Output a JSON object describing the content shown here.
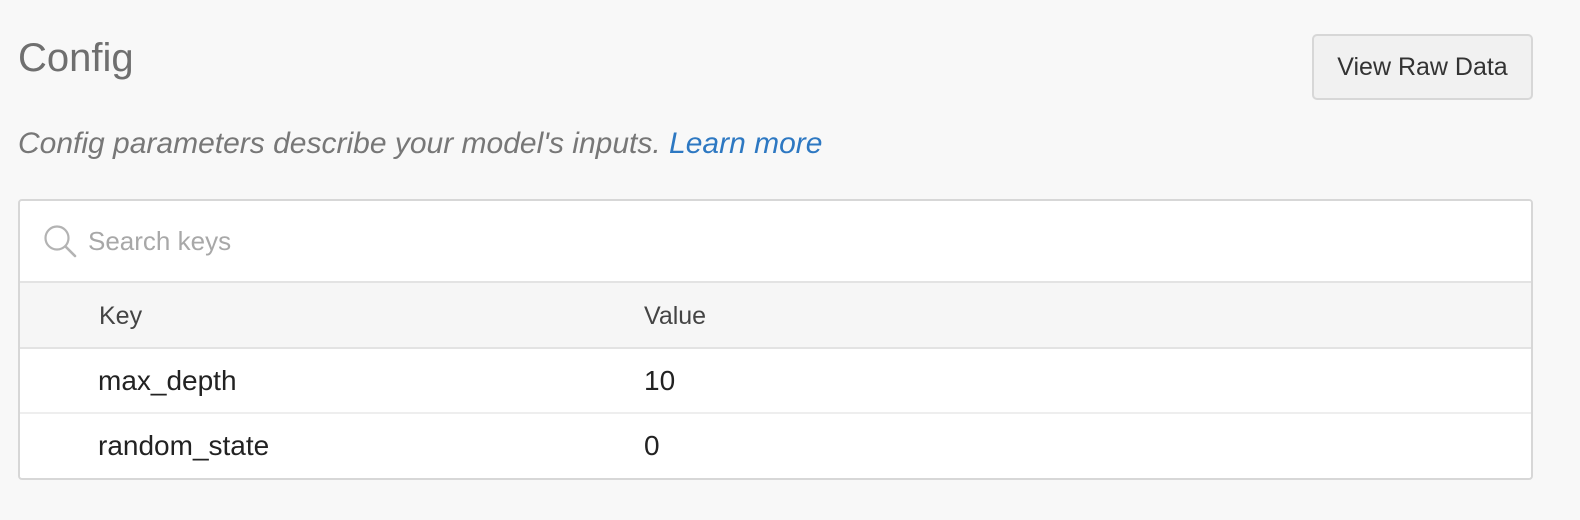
{
  "header": {
    "title": "Config",
    "raw_button_label": "View Raw Data"
  },
  "description": {
    "text": "Config parameters describe your model's inputs. ",
    "link_label": "Learn more"
  },
  "search": {
    "placeholder": "Search keys",
    "value": "",
    "icon": "search-icon"
  },
  "table": {
    "columns": [
      "Key",
      "Value"
    ],
    "rows": [
      {
        "key": "max_depth",
        "value": "10"
      },
      {
        "key": "random_state",
        "value": "0"
      }
    ]
  },
  "colors": {
    "link": "#2d78c2",
    "background": "#f8f8f8",
    "panel_border": "#d7d7d7"
  }
}
